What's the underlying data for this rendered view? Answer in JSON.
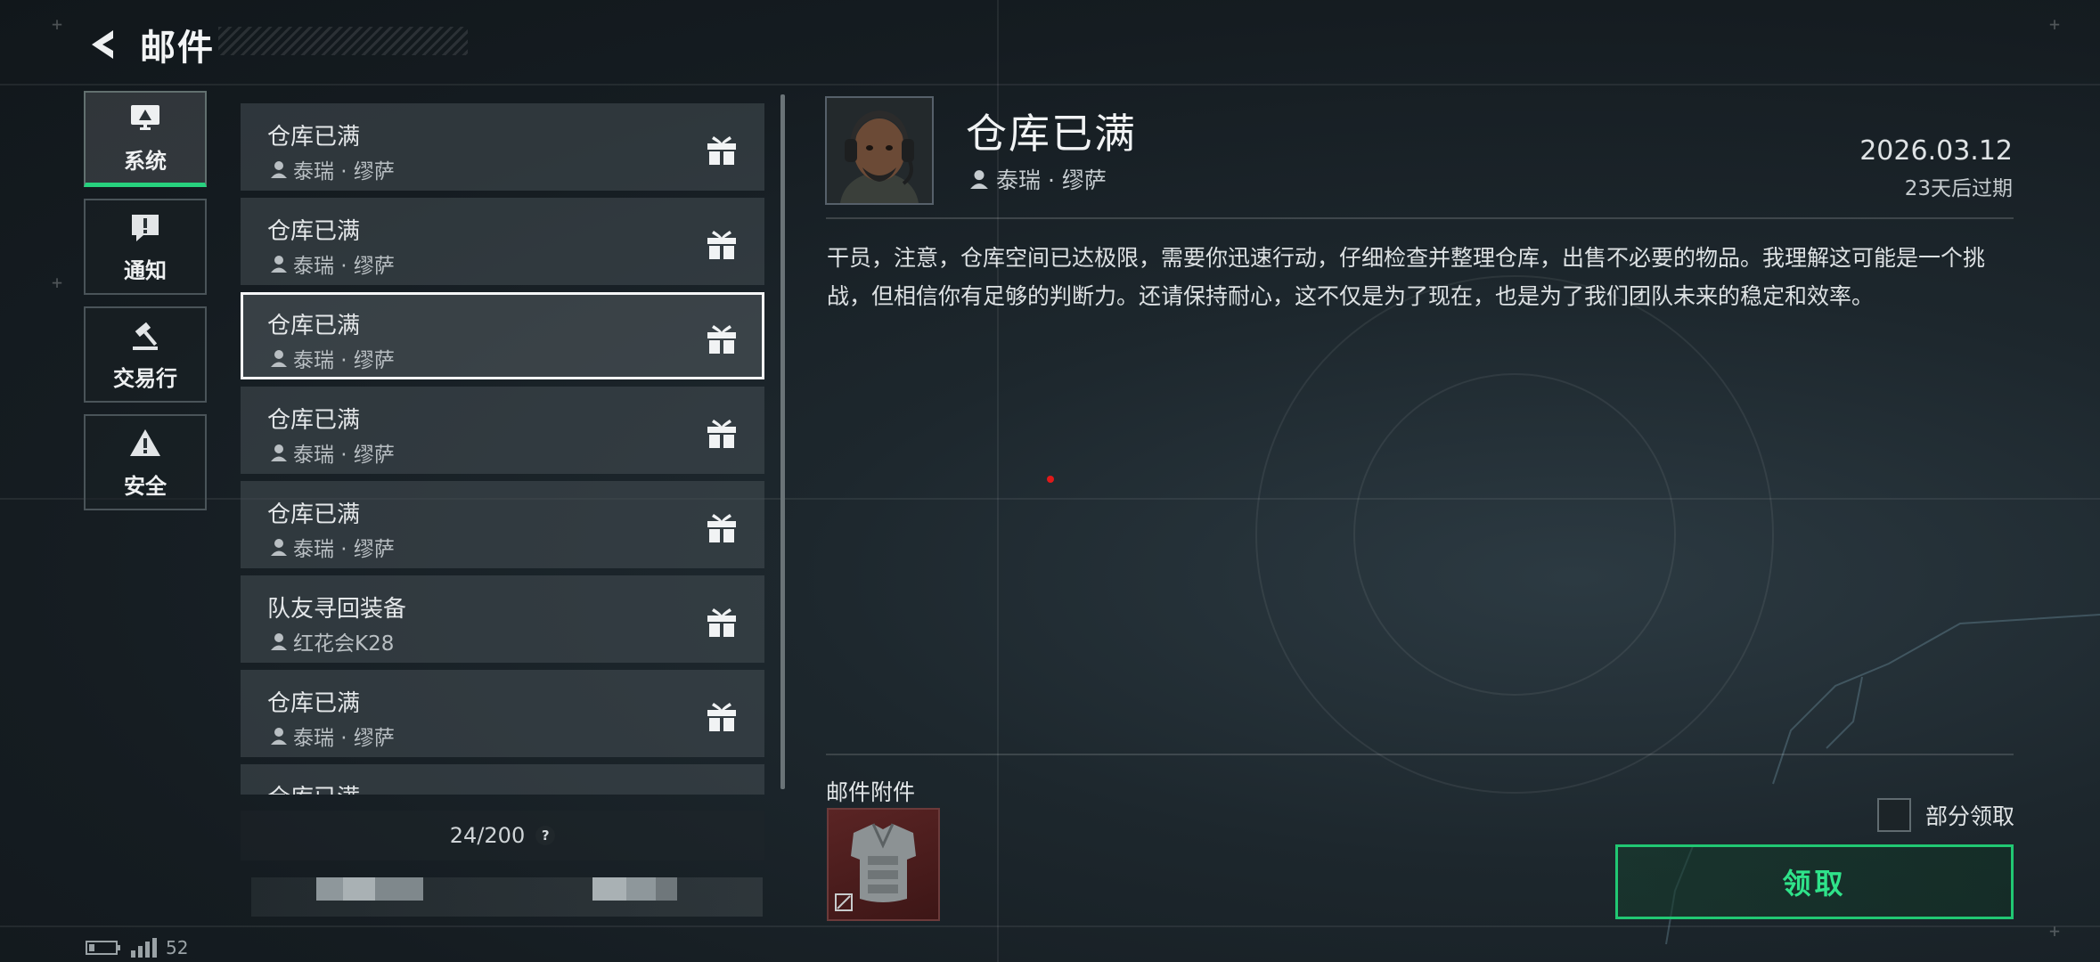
{
  "header": {
    "title": "邮件",
    "back_icon": "back-arrow-icon"
  },
  "categories": [
    {
      "label": "系统",
      "icon": "monitor-icon",
      "active": true
    },
    {
      "label": "通知",
      "icon": "alert-message-icon",
      "active": false
    },
    {
      "label": "交易行",
      "icon": "gavel-icon",
      "active": false
    },
    {
      "label": "安全",
      "icon": "warning-triangle-icon",
      "active": false
    }
  ],
  "mails": [
    {
      "title": "仓库已满",
      "sender": "泰瑞 · 缪萨",
      "icon": "gift-icon"
    },
    {
      "title": "仓库已满",
      "sender": "泰瑞 · 缪萨",
      "icon": "gift-icon"
    },
    {
      "title": "仓库已满",
      "sender": "泰瑞 · 缪萨",
      "icon": "gift-icon",
      "selected": true
    },
    {
      "title": "仓库已满",
      "sender": "泰瑞 · 缪萨",
      "icon": "gift-icon"
    },
    {
      "title": "仓库已满",
      "sender": "泰瑞 · 缪萨",
      "icon": "gift-icon"
    },
    {
      "title": "队友寻回装备",
      "sender": "红花会K28",
      "icon": "gift-icon"
    },
    {
      "title": "仓库已满",
      "sender": "泰瑞 · 缪萨",
      "icon": "gift-icon"
    },
    {
      "title": "仓库已满",
      "sender": "",
      "icon": ""
    }
  ],
  "mail_count": "24/200",
  "help_label": "?",
  "status": {
    "battery_icon": "battery-icon",
    "signal_icon": "signal-icon",
    "partial_text": "52"
  },
  "detail": {
    "title": "仓库已满",
    "sender": "泰瑞 · 缪萨",
    "date": "2026.03.12",
    "expire": "23天后过期",
    "body": "干员，注意，仓库空间已达极限，需要你迅速行动，仔细检查并整理仓库，出售不必要的物品。我理解这可能是一个挑战，但相信你有足够的判断力。还请保持耐心，这不仅是为了现在，也是为了我们团队未来的稳定和效率。",
    "attachment_label": "邮件附件",
    "attachment_icon": "body-armor-icon",
    "partial_claim_label": "部分领取",
    "claim_label": "领取"
  },
  "colors": {
    "accent_green": "#27d17e",
    "attachment_bg": "#4a1c1c",
    "selected_border": "#f5f6f7"
  }
}
